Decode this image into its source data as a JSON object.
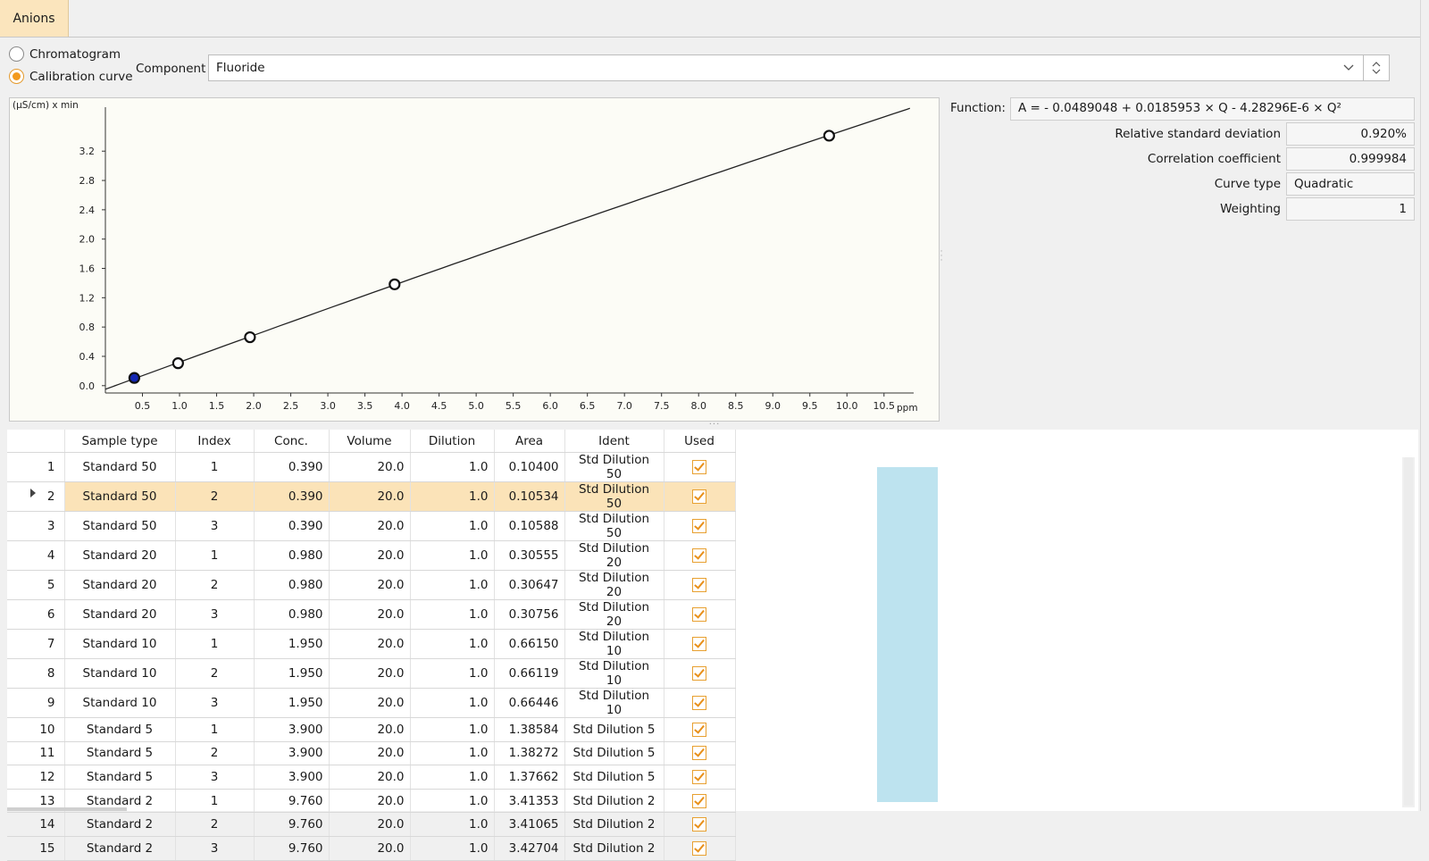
{
  "tabs": [
    {
      "label": "Anions",
      "active": true
    }
  ],
  "display_mode": {
    "options": [
      {
        "label": "Chromatogram",
        "selected": false
      },
      {
        "label": "Calibration curve",
        "selected": true
      }
    ]
  },
  "component": {
    "label": "Component",
    "value": "Fluoride"
  },
  "properties": {
    "function_label": "Function:",
    "function_value": "A = - 0.0489048 + 0.0185953 × Q - 4.28296E-6 × Q²",
    "rows": [
      {
        "label": "Relative standard deviation",
        "value": "0.920%"
      },
      {
        "label": "Correlation coefficient",
        "value": "0.999984"
      },
      {
        "label": "Curve type",
        "value": "Quadratic"
      },
      {
        "label": "Weighting",
        "value": "1"
      }
    ]
  },
  "chart_data": {
    "type": "scatter",
    "ylabel": "(µS/cm) x min",
    "xlabel": "ppm",
    "xlim": [
      0,
      10.9
    ],
    "ylim": [
      -0.1,
      3.8
    ],
    "x_ticks": [
      "0.5",
      "1.0",
      "1.5",
      "2.0",
      "2.5",
      "3.0",
      "3.5",
      "4.0",
      "4.5",
      "5.0",
      "5.5",
      "6.0",
      "6.5",
      "7.0",
      "7.5",
      "8.0",
      "8.5",
      "9.0",
      "9.5",
      "10.0",
      "10.5"
    ],
    "y_ticks": [
      "0.0",
      "0.4",
      "0.8",
      "1.2",
      "1.6",
      "2.0",
      "2.4",
      "2.8",
      "3.2"
    ],
    "points": [
      {
        "x": 0.39,
        "y": 0.10534,
        "highlighted": true
      },
      {
        "x": 0.98,
        "y": 0.30647
      },
      {
        "x": 1.95,
        "y": 0.66119
      },
      {
        "x": 3.9,
        "y": 1.38272
      },
      {
        "x": 9.76,
        "y": 3.41065
      }
    ],
    "curve": {
      "a0": -0.0489048,
      "a1": 0.0185953,
      "a2": -4.28296e-06,
      "x_unit_factor": 20,
      "x_range": [
        0,
        10.85
      ]
    },
    "grid": false,
    "colors": {
      "point_highlight": "#1427b4",
      "line": "#222222"
    }
  },
  "table": {
    "columns": [
      "Sample type",
      "Index",
      "Conc.",
      "Volume",
      "Dilution",
      "Area",
      "Ident",
      "Used"
    ],
    "selected_row": 2,
    "rows": [
      {
        "n": "1",
        "type": "Standard 50",
        "index": "1",
        "conc": "0.390",
        "vol": "20.0",
        "dil": "1.0",
        "area": "0.10400",
        "ident": "Std Dilution 50"
      },
      {
        "n": "2",
        "type": "Standard 50",
        "index": "2",
        "conc": "0.390",
        "vol": "20.0",
        "dil": "1.0",
        "area": "0.10534",
        "ident": "Std Dilution 50"
      },
      {
        "n": "3",
        "type": "Standard 50",
        "index": "3",
        "conc": "0.390",
        "vol": "20.0",
        "dil": "1.0",
        "area": "0.10588",
        "ident": "Std Dilution 50"
      },
      {
        "n": "4",
        "type": "Standard 20",
        "index": "1",
        "conc": "0.980",
        "vol": "20.0",
        "dil": "1.0",
        "area": "0.30555",
        "ident": "Std Dilution 20"
      },
      {
        "n": "5",
        "type": "Standard 20",
        "index": "2",
        "conc": "0.980",
        "vol": "20.0",
        "dil": "1.0",
        "area": "0.30647",
        "ident": "Std Dilution 20"
      },
      {
        "n": "6",
        "type": "Standard 20",
        "index": "3",
        "conc": "0.980",
        "vol": "20.0",
        "dil": "1.0",
        "area": "0.30756",
        "ident": "Std Dilution 20"
      },
      {
        "n": "7",
        "type": "Standard 10",
        "index": "1",
        "conc": "1.950",
        "vol": "20.0",
        "dil": "1.0",
        "area": "0.66150",
        "ident": "Std Dilution 10"
      },
      {
        "n": "8",
        "type": "Standard 10",
        "index": "2",
        "conc": "1.950",
        "vol": "20.0",
        "dil": "1.0",
        "area": "0.66119",
        "ident": "Std Dilution 10"
      },
      {
        "n": "9",
        "type": "Standard 10",
        "index": "3",
        "conc": "1.950",
        "vol": "20.0",
        "dil": "1.0",
        "area": "0.66446",
        "ident": "Std Dilution 10"
      },
      {
        "n": "10",
        "type": "Standard 5",
        "index": "1",
        "conc": "3.900",
        "vol": "20.0",
        "dil": "1.0",
        "area": "1.38584",
        "ident": "Std Dilution 5"
      },
      {
        "n": "11",
        "type": "Standard 5",
        "index": "2",
        "conc": "3.900",
        "vol": "20.0",
        "dil": "1.0",
        "area": "1.38272",
        "ident": "Std Dilution 5"
      },
      {
        "n": "12",
        "type": "Standard 5",
        "index": "3",
        "conc": "3.900",
        "vol": "20.0",
        "dil": "1.0",
        "area": "1.37662",
        "ident": "Std Dilution 5"
      },
      {
        "n": "13",
        "type": "Standard 2",
        "index": "1",
        "conc": "9.760",
        "vol": "20.0",
        "dil": "1.0",
        "area": "3.41353",
        "ident": "Std Dilution 2"
      },
      {
        "n": "14",
        "type": "Standard 2",
        "index": "2",
        "conc": "9.760",
        "vol": "20.0",
        "dil": "1.0",
        "area": "3.41065",
        "ident": "Std Dilution 2"
      },
      {
        "n": "15",
        "type": "Standard 2",
        "index": "3",
        "conc": "9.760",
        "vol": "20.0",
        "dil": "1.0",
        "area": "3.42704",
        "ident": "Std Dilution 2"
      }
    ]
  },
  "icons": {
    "combo_arrow": "chevron-down-icon",
    "combo_spin": "spin-updown-icon",
    "used": "checkbox-checked-icon",
    "row_pointer": "row-pointer-icon"
  }
}
